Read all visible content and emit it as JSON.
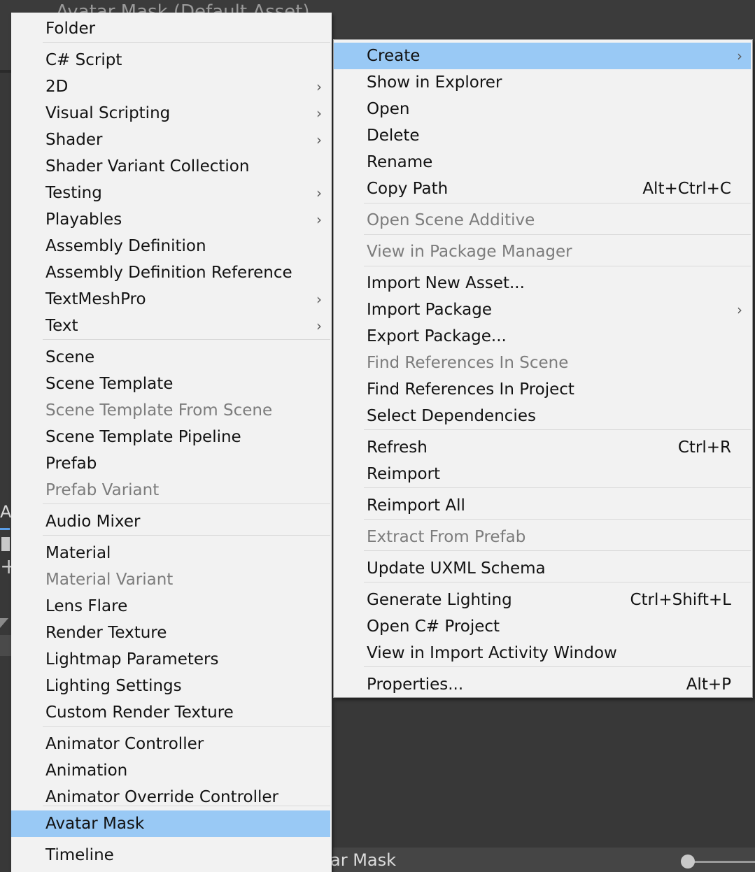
{
  "background": {
    "title": "Avatar Mask (Default Asset)",
    "side_letter": "A",
    "bottom_label": "ar Mask"
  },
  "left_menu": {
    "items": [
      {
        "label": "Folder"
      },
      {
        "label": "C# Script"
      },
      {
        "label": "2D",
        "submenu": true
      },
      {
        "label": "Visual Scripting",
        "submenu": true
      },
      {
        "label": "Shader",
        "submenu": true
      },
      {
        "label": "Shader Variant Collection"
      },
      {
        "label": "Testing",
        "submenu": true
      },
      {
        "label": "Playables",
        "submenu": true
      },
      {
        "label": "Assembly Definition"
      },
      {
        "label": "Assembly Definition Reference"
      },
      {
        "label": "TextMeshPro",
        "submenu": true
      },
      {
        "label": "Text",
        "submenu": true
      },
      {
        "label": "Scene"
      },
      {
        "label": "Scene Template"
      },
      {
        "label": "Scene Template From Scene",
        "disabled": true
      },
      {
        "label": "Scene Template Pipeline"
      },
      {
        "label": "Prefab"
      },
      {
        "label": "Prefab Variant",
        "disabled": true
      },
      {
        "label": "Audio Mixer"
      },
      {
        "label": "Material"
      },
      {
        "label": "Material Variant",
        "disabled": true
      },
      {
        "label": "Lens Flare"
      },
      {
        "label": "Render Texture"
      },
      {
        "label": "Lightmap Parameters"
      },
      {
        "label": "Lighting Settings"
      },
      {
        "label": "Custom Render Texture"
      },
      {
        "label": "Animator Controller"
      },
      {
        "label": "Animation"
      },
      {
        "label": "Animator Override Controller"
      },
      {
        "label": "Avatar Mask",
        "highlighted": true
      },
      {
        "label": "Timeline"
      }
    ]
  },
  "right_menu": {
    "items": [
      {
        "label": "Create",
        "submenu": true,
        "highlighted": true
      },
      {
        "label": "Show in Explorer"
      },
      {
        "label": "Open"
      },
      {
        "label": "Delete"
      },
      {
        "label": "Rename"
      },
      {
        "label": "Copy Path",
        "shortcut": "Alt+Ctrl+C"
      },
      {
        "label": "Open Scene Additive",
        "disabled": true
      },
      {
        "label": "View in Package Manager",
        "disabled": true
      },
      {
        "label": "Import New Asset..."
      },
      {
        "label": "Import Package",
        "submenu": true
      },
      {
        "label": "Export Package..."
      },
      {
        "label": "Find References In Scene",
        "disabled": true
      },
      {
        "label": "Find References In Project"
      },
      {
        "label": "Select Dependencies"
      },
      {
        "label": "Refresh",
        "shortcut": "Ctrl+R"
      },
      {
        "label": "Reimport"
      },
      {
        "label": "Reimport All"
      },
      {
        "label": "Extract From Prefab",
        "disabled": true
      },
      {
        "label": "Update UXML Schema"
      },
      {
        "label": "Generate Lighting",
        "shortcut": "Ctrl+Shift+L"
      },
      {
        "label": "Open C# Project"
      },
      {
        "label": "View in Import Activity Window"
      },
      {
        "label": "Properties...",
        "shortcut": "Alt+P"
      }
    ]
  },
  "colors": {
    "menu_bg": "#f2f2f2",
    "highlight": "#99c9f5",
    "disabled_text": "#7c7c7c",
    "editor_bg": "#383838"
  },
  "icons": {
    "submenu_arrow": "›"
  }
}
